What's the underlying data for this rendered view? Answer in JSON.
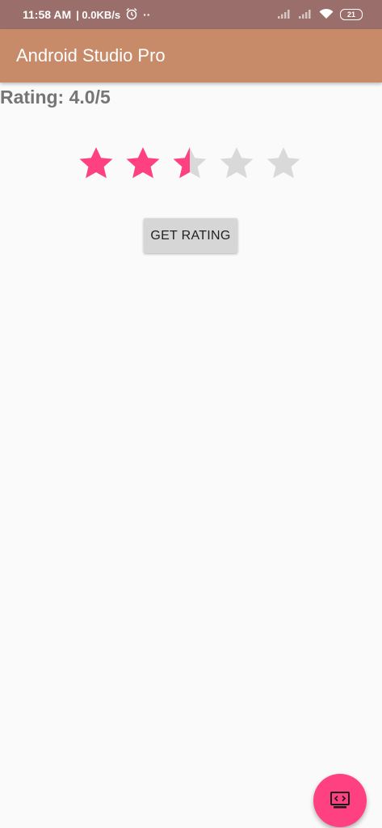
{
  "status_bar": {
    "time": "11:58 AM",
    "network_speed": "| 0.0KB/s",
    "dots": "··",
    "battery": "21",
    "icons": [
      "alarm-icon",
      "signal-icon",
      "signal-icon",
      "wifi-icon",
      "battery-icon"
    ]
  },
  "app_bar": {
    "title": "Android Studio Pro"
  },
  "rating": {
    "label": "Rating: 4.0/5",
    "stars_total": 5,
    "stars_filled": 2.5,
    "filled_color": "#ff4081",
    "empty_color": "#d9d9d9"
  },
  "button": {
    "label": "GET RATING"
  },
  "fab": {
    "icon": "screen-code-icon",
    "color": "#ff4081"
  },
  "colors": {
    "status_bar": "#9a6e6a",
    "app_bar": "#c78b6a",
    "background": "#fafafa"
  }
}
